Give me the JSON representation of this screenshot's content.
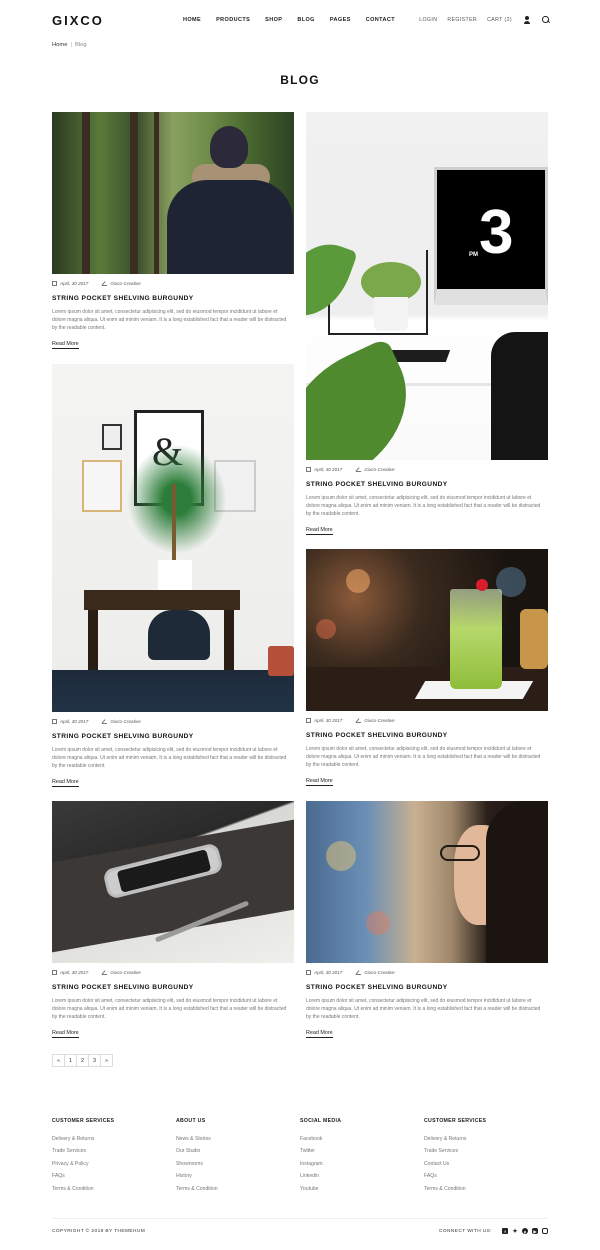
{
  "brand": {
    "logo": "GIXCO"
  },
  "nav": {
    "items": [
      "HOME",
      "PRODUCTS",
      "SHOP",
      "BLOG",
      "PAGES",
      "CONTACT"
    ]
  },
  "account": {
    "login": "LOGIN",
    "register": "REGISTER",
    "cart": "CART (2)"
  },
  "breadcrumb": {
    "home": "Home",
    "sep": "|",
    "current": "Blog"
  },
  "page": {
    "title": "BLOG"
  },
  "posts": [
    {
      "date": "April, 30 2017",
      "author": "Gixco-Creative",
      "title": "STRING POCKET SHELVING BURGUNDY",
      "excerpt": "Lorem ipsum dolor sit amet, consectetur adipisicing elit, sed do eiusmod tempor incididunt ut labore et dolore magna aliqua. Ut enim ad minim veniam. It is a long established fact that a reader will be distracted by the readable content.",
      "more": "Read More"
    },
    {
      "date": "April, 30 2017",
      "author": "Gixco-Creative",
      "title": "STRING POCKET SHELVING BURGUNDY",
      "excerpt": "Lorem ipsum dolor sit amet, consectetur adipisicing elit, sed do eiusmod tempor incididunt ut labore et dolore magna aliqua. Ut enim ad minim veniam. It is a long established fact that a reader will be distracted by the readable content.",
      "more": "Read More"
    },
    {
      "date": "April, 30 2017",
      "author": "Gixco-Creative",
      "title": "STRING POCKET SHELVING BURGUNDY",
      "excerpt": "Lorem ipsum dolor sit amet, consectetur adipisicing elit, sed do eiusmod tempor incididunt ut labore et dolore magna aliqua. Ut enim ad minim veniam. It is a long established fact that a reader will be distracted by the readable content.",
      "more": "Read More"
    },
    {
      "date": "April, 30 2017",
      "author": "Gixco-Creative",
      "title": "STRING POCKET SHELVING BURGUNDY",
      "excerpt": "Lorem ipsum dolor sit amet, consectetur adipisicing elit, sed do eiusmod tempor incididunt ut labore et dolore magna aliqua. Ut enim ad minim veniam. It is a long established fact that a reader will be distracted by the readable content.",
      "more": "Read More"
    },
    {
      "date": "April, 30 2017",
      "author": "Gixco-Creative",
      "title": "STRING POCKET SHELVING BURGUNDY",
      "excerpt": "Lorem ipsum dolor sit amet, consectetur adipisicing elit, sed do eiusmod tempor incididunt ut labore et dolore magna aliqua. Ut enim ad minim veniam. It is a long established fact that a reader will be distracted by the readable content.",
      "more": "Read More"
    },
    {
      "date": "April, 30 2017",
      "author": "Gixco-Creative",
      "title": "STRING POCKET SHELVING BURGUNDY",
      "excerpt": "Lorem ipsum dolor sit amet, consectetur adipisicing elit, sed do eiusmod tempor incididunt ut labore et dolore magna aliqua. Ut enim ad minim veniam. It is a long established fact that a reader will be distracted by the readable content.",
      "more": "Read More"
    }
  ],
  "image_text": {
    "clock_number": "3",
    "clock_pm": "PM",
    "ampersand": "&"
  },
  "pagination": {
    "prev": "«",
    "pages": [
      "1",
      "2",
      "3"
    ],
    "next": "»"
  },
  "footer": {
    "columns": [
      {
        "title": "CUSTOMER SERVICES",
        "links": [
          "Delivery & Returns",
          "Trade Services",
          "Privacy & Policy",
          "FAQs",
          "Terms & Condition"
        ]
      },
      {
        "title": "ABOUT US",
        "links": [
          "News & Stories",
          "Our Studio",
          "Showrooms",
          "History",
          "Terms & Condition"
        ]
      },
      {
        "title": "SOCIAL MEDIA",
        "links": [
          "Facebook",
          "Twitter",
          "Instagram",
          "Linkedin",
          "Youtube"
        ]
      },
      {
        "title": "CUSTOMER SERVICES",
        "links": [
          "Delivery & Returns",
          "Trade Services",
          "Contact Us",
          "FAQs",
          "Terms & Condition"
        ]
      }
    ],
    "copyright": "COPYRIGHT © 2019 BY THEMEHUM",
    "connect_label": "CONNECT WITH US:",
    "social_icons": [
      "facebook-icon",
      "twitter-icon",
      "pinterest-icon",
      "youtube-icon",
      "instagram-icon"
    ]
  }
}
